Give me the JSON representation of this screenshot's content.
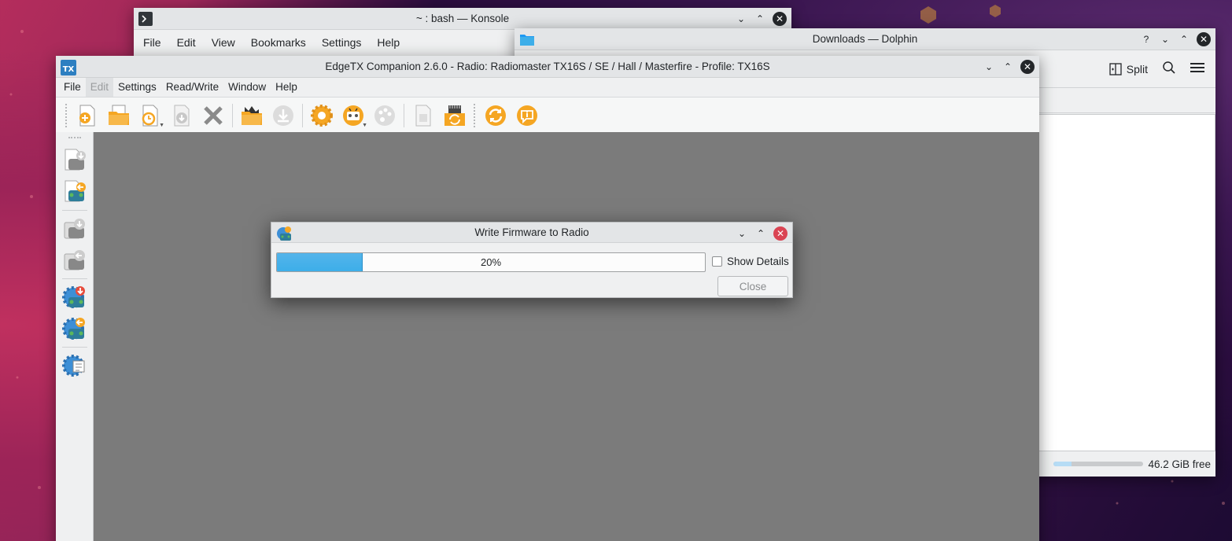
{
  "konsole": {
    "title": "~ : bash — Konsole",
    "menu": [
      "File",
      "Edit",
      "View",
      "Bookmarks",
      "Settings",
      "Help"
    ]
  },
  "dolphin": {
    "title": "Downloads — Dolphin",
    "split_label": "Split",
    "free_space": "46.2 GiB free",
    "space_used_fraction": 0.2
  },
  "edgetx": {
    "title": "EdgeTX Companion 2.6.0 - Radio: Radiomaster TX16S / SE / Hall / Masterfire - Profile: TX16S",
    "menu": [
      "File",
      "Edit",
      "Settings",
      "Read/Write",
      "Window",
      "Help"
    ],
    "toolbar_icons": [
      "new-file-icon",
      "open-file-icon",
      "recent-files-icon",
      "save-icon",
      "close-file-icon",
      "open-sd-folder-icon",
      "download-icon",
      "settings-icon",
      "radio-profiles-icon",
      "palette-icon",
      "print-icon",
      "sd-sync-icon",
      "check-update-icon",
      "about-icon"
    ],
    "sidebar_icons": [
      "read-models-icon",
      "write-models-icon",
      "read-backup-icon",
      "write-backup-icon",
      "read-firmware-icon",
      "write-firmware-icon",
      "radio-settings-icon"
    ]
  },
  "dialog": {
    "title": "Write Firmware to Radio",
    "progress_percent": 20,
    "progress_text": "20%",
    "show_details_label": "Show Details",
    "close_label": "Close"
  }
}
